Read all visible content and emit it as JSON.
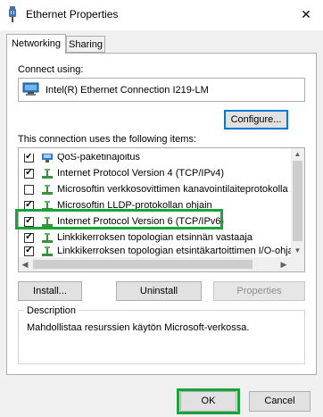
{
  "window": {
    "title": "Ethernet Properties",
    "close_glyph": "✕"
  },
  "tabs": [
    {
      "label": "Networking",
      "selected": true
    },
    {
      "label": "Sharing",
      "selected": false
    }
  ],
  "connect": {
    "label": "Connect using:",
    "adapter_name": "Intel(R) Ethernet Connection I219-LM",
    "configure_label": "Configure..."
  },
  "items": {
    "label": "This connection uses the following items:",
    "list": [
      {
        "label": "QoS-paketinajoitus",
        "checked": true
      },
      {
        "label": "Internet Protocol Version 4 (TCP/IPv4)",
        "checked": true
      },
      {
        "label": "Microsoftin verkkosovittimen kanavointilaiteprotokolla",
        "checked": false
      },
      {
        "label": "Microsoftin LLDP-protokollan ohjain",
        "checked": true
      },
      {
        "label": "Internet Protocol Version 6 (TCP/IPv6)",
        "checked": true
      },
      {
        "label": "Linkkikerroksen topologian etsinnän vastaaja",
        "checked": true
      },
      {
        "label": "Linkkikerroksen topologian etsintäkartoittimen I/O-ohjain",
        "checked": true
      }
    ],
    "highlighted_index": 4
  },
  "buttons": {
    "install": "Install...",
    "uninstall": "Uninstall",
    "properties": "Properties",
    "ok": "OK",
    "cancel": "Cancel"
  },
  "description": {
    "title": "Description",
    "text": "Mahdollistaa resurssien käytön Microsoft-verkossa."
  },
  "colors": {
    "highlight": "#1aa338",
    "focus_border": "#0078d7",
    "accent_blue": "#1e6fc9"
  }
}
